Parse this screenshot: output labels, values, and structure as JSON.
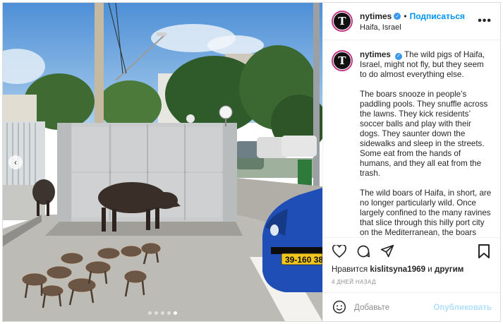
{
  "post": {
    "username": "nytimes",
    "separator": "•",
    "follow_label": "Подписаться",
    "location": "Haifa, Israel",
    "more_label": "•••",
    "avatar_letter": "T",
    "verified_mark": "✓"
  },
  "caption": {
    "username": "nytimes",
    "paragraphs": [
      "The wild pigs of Haifa, Israel, might not fly, but they seem to do almost everything else.",
      "The boars snooze in people’s paddling pools. They snuffle across the lawns. They kick residents’ soccer balls and play with their dogs. They saunter down the sidewalks and sleep in the streets. Some eat from the hands of humans, and they all eat from the trash.",
      "The wild boars of Haifa, in short, are no longer particularly wild. Once largely confined to the many ravines that slice through this hilly port city on the Mediterranean, the boars have become increasingly carefree in recent years and now regularly venture into built-up"
    ]
  },
  "likes": {
    "prefix": "Нравится",
    "user": "kislitsyna1969",
    "and": "и",
    "others": "другим"
  },
  "date": "4 ДНЕЙ НАЗАД",
  "comment": {
    "placeholder": "Добавьте",
    "post_label": "Опубликовать"
  },
  "photo": {
    "plate_text": "39-160 38",
    "carousel_dots": 5,
    "active_dot": 4,
    "prev_arrow": "‹"
  },
  "icons": [
    "heart-icon",
    "comment-icon",
    "share-icon",
    "bookmark-icon",
    "emoji-icon",
    "chevron-left-icon",
    "verified-icon",
    "more-icon"
  ],
  "colors": {
    "link": "#0095f6",
    "verified": "#3897f0",
    "post_disabled": "#b2dffc",
    "muted": "#8e8e8e",
    "car": "#1f4fb6"
  }
}
